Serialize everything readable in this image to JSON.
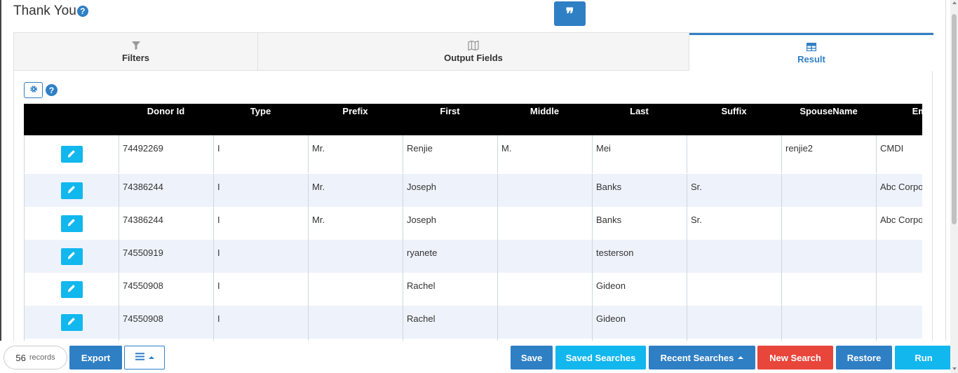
{
  "page": {
    "title": "Thank You"
  },
  "tabs": [
    {
      "label": "Filters",
      "icon": "filter-icon"
    },
    {
      "label": "Output Fields",
      "icon": "map-icon"
    },
    {
      "label": "Result",
      "icon": "table-icon",
      "active": true
    }
  ],
  "grid": {
    "columns": [
      "",
      "Donor Id",
      "Type",
      "Prefix",
      "First",
      "Middle",
      "Last",
      "Suffix",
      "SpouseName",
      "Empl"
    ],
    "rows": [
      [
        "74492269",
        "I",
        "Mr.",
        "Renjie",
        "M.",
        "Mei",
        "",
        "renjie2",
        "CMDI"
      ],
      [
        "74386244",
        "I",
        "Mr.",
        "Joseph",
        "",
        "Banks",
        "Sr.",
        "",
        "Abc Corpo"
      ],
      [
        "74386244",
        "I",
        "Mr.",
        "Joseph",
        "",
        "Banks",
        "Sr.",
        "",
        "Abc Corpo"
      ],
      [
        "74550919",
        "I",
        "",
        "ryanete",
        "",
        "testerson",
        "",
        "",
        ""
      ],
      [
        "74550908",
        "I",
        "",
        "Rachel",
        "",
        "Gideon",
        "",
        "",
        ""
      ],
      [
        "74550908",
        "I",
        "",
        "Rachel",
        "",
        "Gideon",
        "",
        "",
        ""
      ],
      [
        "",
        "",
        "",
        "",
        "",
        "",
        "",
        "",
        ""
      ]
    ]
  },
  "footer": {
    "record_count": "56",
    "record_unit": "records",
    "export": "Export",
    "save": "Save",
    "saved_searches": "Saved Searches",
    "recent_searches": "Recent Searches",
    "new_search": "New Search",
    "restore": "Restore",
    "run": "Run"
  },
  "colors": {
    "primary": "#2f7fc4",
    "cyan": "#12b7ee",
    "danger": "#e8463b",
    "header_bg": "#000000",
    "row_alt": "#eef3fb"
  }
}
